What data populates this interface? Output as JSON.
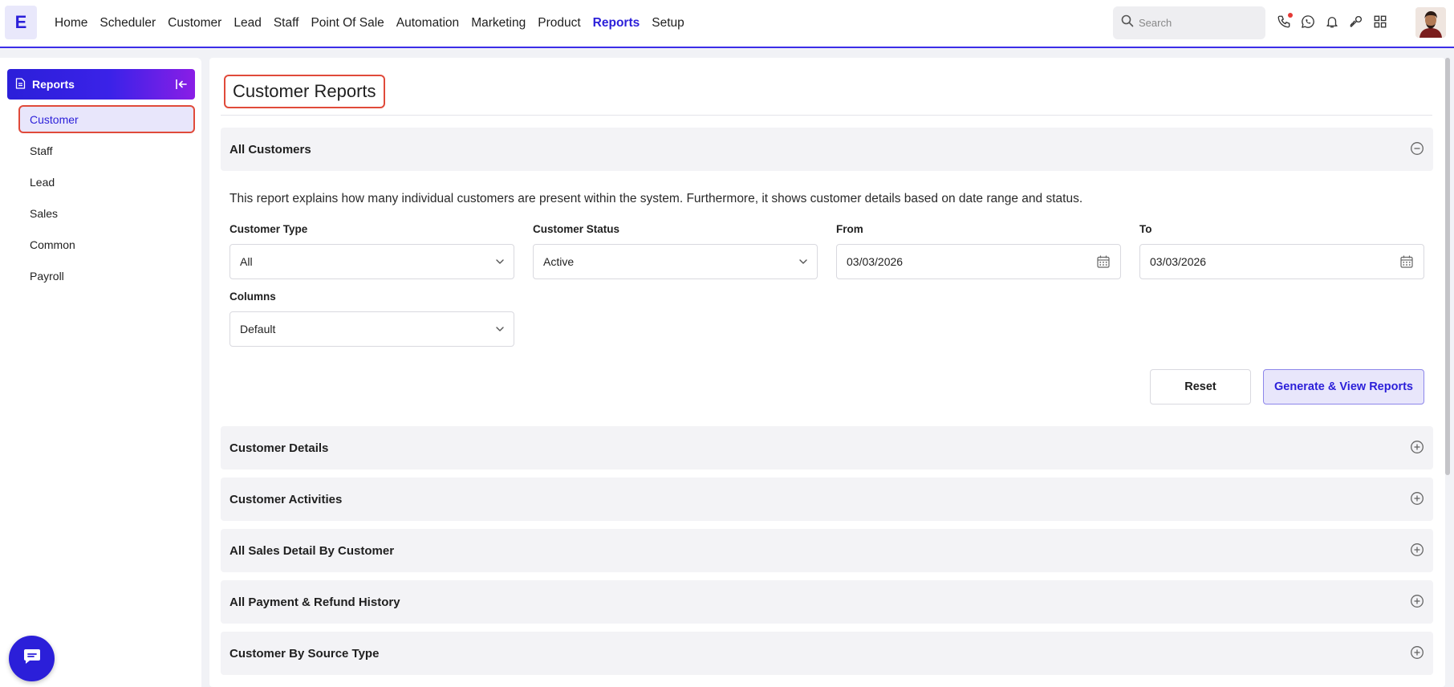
{
  "app": {
    "logo_letter": "E",
    "accent_color": "#2b1fd9"
  },
  "nav": {
    "items": [
      {
        "label": "Home"
      },
      {
        "label": "Scheduler"
      },
      {
        "label": "Customer"
      },
      {
        "label": "Lead"
      },
      {
        "label": "Staff"
      },
      {
        "label": "Point Of Sale"
      },
      {
        "label": "Automation"
      },
      {
        "label": "Marketing"
      },
      {
        "label": "Product"
      },
      {
        "label": "Reports",
        "active": true
      },
      {
        "label": "Setup"
      }
    ]
  },
  "search": {
    "placeholder": "Search",
    "value": ""
  },
  "top_icons": [
    "phone-icon",
    "whatsapp-icon",
    "bell-icon",
    "key-icon",
    "apps-grid-icon"
  ],
  "sidebar": {
    "header": "Reports",
    "items": [
      {
        "label": "Customer",
        "active": true
      },
      {
        "label": "Staff"
      },
      {
        "label": "Lead"
      },
      {
        "label": "Sales"
      },
      {
        "label": "Common"
      },
      {
        "label": "Payroll"
      }
    ]
  },
  "main": {
    "title": "Customer Reports",
    "all_customers": {
      "title": "All Customers",
      "expanded": true,
      "description": "This report explains how many individual customers are present within the system. Furthermore, it shows customer details based on date range and status.",
      "filters": {
        "customer_type": {
          "label": "Customer Type",
          "value": "All"
        },
        "customer_status": {
          "label": "Customer Status",
          "value": "Active"
        },
        "from": {
          "label": "From",
          "value": "03/03/2026"
        },
        "to": {
          "label": "To",
          "value": "03/03/2026"
        },
        "columns": {
          "label": "Columns",
          "value": "Default"
        }
      },
      "buttons": {
        "reset": "Reset",
        "generate": "Generate & View Reports"
      }
    },
    "sections": [
      {
        "title": "Customer Details"
      },
      {
        "title": "Customer Activities"
      },
      {
        "title": "All Sales Detail By Customer"
      },
      {
        "title": "All Payment & Refund History"
      },
      {
        "title": "Customer By Source Type"
      }
    ]
  }
}
